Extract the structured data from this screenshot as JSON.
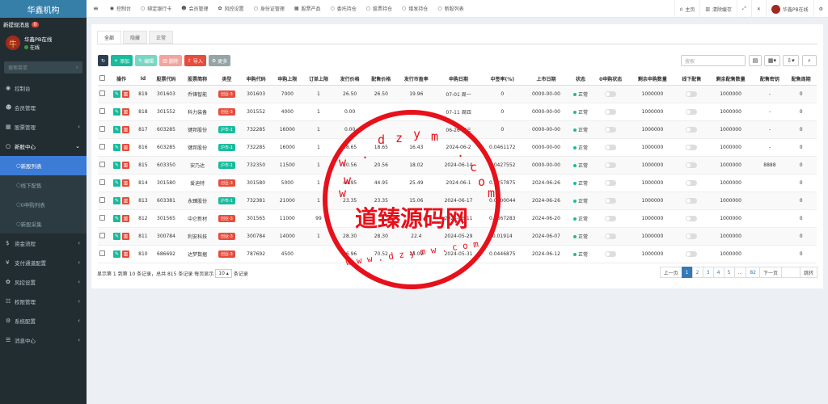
{
  "sidebar": {
    "logo": "华鑫机构",
    "notice_label": "新提现消息",
    "notice_count": "0",
    "avatar_glyph": "牛",
    "user_name": "华鑫PB在线",
    "user_status": "在线",
    "search_placeholder": "搜索菜单",
    "items": [
      {
        "label": "控制台",
        "icon": "dashboard-icon",
        "glyph": "◉"
      },
      {
        "label": "会员管理",
        "icon": "user-icon",
        "glyph": "☻"
      },
      {
        "label": "股票管理",
        "icon": "bank-icon",
        "glyph": "▦"
      },
      {
        "label": "新股中心",
        "icon": "circle-icon",
        "glyph": "○"
      },
      {
        "label": "资金流程",
        "icon": "dollar-icon",
        "glyph": "$"
      },
      {
        "label": "支付通道配置",
        "icon": "yen-icon",
        "glyph": "¥"
      },
      {
        "label": "风控设置",
        "icon": "gear-icon",
        "glyph": "✿"
      },
      {
        "label": "权限管理",
        "icon": "group-icon",
        "glyph": "☷"
      },
      {
        "label": "系统配置",
        "icon": "cogs-icon",
        "glyph": "⚙"
      },
      {
        "label": "消息中心",
        "icon": "list-icon",
        "glyph": "☰"
      }
    ],
    "sub_items": [
      "新股列表",
      "线下配售",
      "0申购列表",
      "新股采集"
    ]
  },
  "topbar": {
    "tabs": [
      {
        "label": "控制台",
        "glyph": "◉"
      },
      {
        "label": "绑定银行卡",
        "glyph": "○"
      },
      {
        "label": "会员管理",
        "glyph": "☻"
      },
      {
        "label": "风控设置",
        "glyph": "✿"
      },
      {
        "label": "身份证管理",
        "glyph": "○"
      },
      {
        "label": "股票产品",
        "glyph": "▦"
      },
      {
        "label": "委托持仓",
        "glyph": "○"
      },
      {
        "label": "股票持仓",
        "glyph": "○"
      },
      {
        "label": "增发持仓",
        "glyph": "○"
      },
      {
        "label": "新股列表",
        "glyph": "○"
      }
    ],
    "home": "主页",
    "clear_cache": "清除缓存",
    "user": "华鑫PB在线"
  },
  "content": {
    "tabs": [
      "全部",
      "隐藏",
      "正常"
    ],
    "toolbar": {
      "add": "添加",
      "edit": "编辑",
      "delete": "删除",
      "import": "导入",
      "more": "更多"
    },
    "search_placeholder": "搜索",
    "columns": [
      "操作",
      "Id",
      "股票代码",
      "股票简称",
      "类型",
      "申购代码",
      "申购上限",
      "订单上限",
      "发行价格",
      "配售价格",
      "发行市盈率",
      "申购日期",
      "中签率(%)",
      "上市日期",
      "状态",
      "0申购状态",
      "剩余申购数量",
      "线下配售",
      "剩余配售数量",
      "配售密钥",
      "配售周期"
    ],
    "rows": [
      {
        "id": "819",
        "code": "301603",
        "name": "乔锋智能",
        "type": "创业-3",
        "tcolor": "red",
        "sub_code": "301603",
        "limit": "7000",
        "order_limit": "1",
        "price": "26.50",
        "place_price": "26.50",
        "pe": "19.96",
        "date": "07-01 周一",
        "rate": "0",
        "list_date": "0000-00-00",
        "status": "正常",
        "remain": "1000000",
        "remain_place": "1000000",
        "key": "-",
        "period": "0"
      },
      {
        "id": "818",
        "code": "301552",
        "name": "科力装备",
        "type": "创业-3",
        "tcolor": "red",
        "sub_code": "301552",
        "limit": "4000",
        "order_limit": "1",
        "price": "0.00",
        "place_price": "",
        "pe": "",
        "date": "07-11 周四",
        "rate": "0",
        "list_date": "0000-00-00",
        "status": "正常",
        "remain": "1000000",
        "remain_place": "1000000",
        "key": "-",
        "period": "0"
      },
      {
        "id": "817",
        "code": "603285",
        "name": "键邦股份",
        "type": "沪市-1",
        "tcolor": "green",
        "sub_code": "732285",
        "limit": "16000",
        "order_limit": "1",
        "price": "0.00",
        "place_price": "",
        "pe": "",
        "date": "06-26 周三",
        "rate": "0",
        "list_date": "0000-00-00",
        "status": "正常",
        "remain": "1000000",
        "remain_place": "1000000",
        "key": "-",
        "period": "0"
      },
      {
        "id": "816",
        "code": "603285",
        "name": "键邦股份",
        "type": "沪市-1",
        "tcolor": "green",
        "sub_code": "732285",
        "limit": "16000",
        "order_limit": "1",
        "price": "18.65",
        "place_price": "18.65",
        "pe": "16.43",
        "date": "2024-06-2",
        "rate": "0.0461172",
        "list_date": "0000-00-00",
        "status": "正常",
        "remain": "1000000",
        "remain_place": "1000000",
        "key": "-",
        "period": "0"
      },
      {
        "id": "815",
        "code": "603350",
        "name": "安乃达",
        "type": "沪市-1",
        "tcolor": "green",
        "sub_code": "732350",
        "limit": "11500",
        "order_limit": "1",
        "price": "20.56",
        "place_price": "20.56",
        "pe": "18.02",
        "date": "2024-06-14",
        "rate": "0.0427552",
        "list_date": "0000-00-00",
        "status": "正常",
        "remain": "1000000",
        "remain_place": "1000000",
        "key": "8888",
        "period": "0"
      },
      {
        "id": "814",
        "code": "301580",
        "name": "爱迪特",
        "type": "创业-3",
        "tcolor": "red",
        "sub_code": "301580",
        "limit": "5000",
        "order_limit": "1",
        "price": "44.95",
        "place_price": "44.95",
        "pe": "25.49",
        "date": "2024-06-1",
        "rate": "0.0257875",
        "list_date": "2024-06-26",
        "status": "正常",
        "remain": "1000000",
        "remain_place": "1000000",
        "key": "",
        "period": "0"
      },
      {
        "id": "813",
        "code": "603381",
        "name": "永臻股份",
        "type": "沪市-1",
        "tcolor": "green",
        "sub_code": "732381",
        "limit": "21000",
        "order_limit": "1",
        "price": "23.35",
        "place_price": "23.35",
        "pe": "15.06",
        "date": "2024-06-17",
        "rate": "0.0500044",
        "list_date": "2024-06-26",
        "status": "正常",
        "remain": "1000000",
        "remain_place": "1000000",
        "key": "",
        "period": "0"
      },
      {
        "id": "812",
        "code": "301565",
        "name": "中仑新材",
        "type": "创业-3",
        "tcolor": "red",
        "sub_code": "301565",
        "limit": "11000",
        "order_limit": "99",
        "price": "",
        "place_price": "",
        "pe": "",
        "date": "2024-06-11",
        "rate": "0.0367283",
        "list_date": "2024-06-20",
        "status": "正常",
        "remain": "1000000",
        "remain_place": "1000000",
        "key": "",
        "period": "0"
      },
      {
        "id": "811",
        "code": "300784",
        "name": "利安科技",
        "type": "创业-3",
        "tcolor": "red",
        "sub_code": "300784",
        "limit": "14000",
        "order_limit": "1",
        "price": "28.30",
        "place_price": "28.30",
        "pe": "22.4",
        "date": "2024-05-29",
        "rate": "0.01914",
        "list_date": "2024-06-07",
        "status": "正常",
        "remain": "1000000",
        "remain_place": "1000000",
        "key": "",
        "period": "0"
      },
      {
        "id": "810",
        "code": "686692",
        "name": "达梦数据",
        "type": "创业-3",
        "tcolor": "red",
        "sub_code": "787692",
        "limit": "4500",
        "order_limit": "",
        "price": "86.96",
        "place_price": "70.52",
        "pe": "24.09",
        "date": "2024-05-31",
        "rate": "0.0446875",
        "list_date": "2024-06-12",
        "status": "正常",
        "remain": "1000000",
        "remain_place": "1000000",
        "key": "",
        "period": "0"
      }
    ],
    "footer": {
      "info": "显示第 1 到第 10 条记录，总共 815 条记录 每页显示",
      "page_size": "10 ▴",
      "suffix": "条记录"
    },
    "pager": {
      "prev": "上一页",
      "pages": [
        "1",
        "2",
        "3",
        "4",
        "5",
        "...",
        "82"
      ],
      "next": "下一页",
      "go": "跳转"
    }
  },
  "watermark": {
    "text": "道臻源码网",
    "letters_top": [
      "w",
      "w",
      "w",
      ".",
      "d",
      "z",
      "y",
      "m",
      ".",
      "c",
      "o",
      "m"
    ],
    "letters_bottom": "w w w . d z y m w . c o m"
  },
  "colors": {
    "sidebar": "#222d32",
    "logo": "#367fa9",
    "accent": "#3c7bd6",
    "success": "#18bc9c",
    "danger": "#e74c3c",
    "stamp": "#e8101a"
  }
}
